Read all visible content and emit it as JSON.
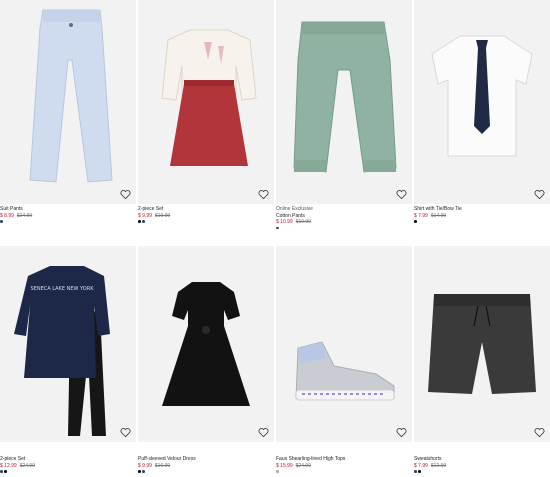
{
  "products": [
    {
      "badge": "",
      "title": "Suit Pants",
      "price": "$ 8.99",
      "original": "$24.99",
      "swatches": [
        "#31486b"
      ]
    },
    {
      "badge": "",
      "title": "2-piece Set",
      "price": "$ 9.99",
      "original": "$19.99",
      "swatches": [
        "#111111",
        "#31486b"
      ]
    },
    {
      "badge": "Online Exclusive",
      "title": "Cotton Pants",
      "price": "$ 10.99",
      "original": "$19.99",
      "swatches": [
        "#31486b"
      ]
    },
    {
      "badge": "",
      "title": "Shirt with Tie/Bow Tie",
      "price": "$ 7.99",
      "original": "$14.99",
      "swatches": [
        "#111111"
      ]
    },
    {
      "badge": "",
      "title": "2-piece Set",
      "price": "$ 12.99",
      "original": "$24.99",
      "swatches": [
        "#31486b",
        "#111111"
      ]
    },
    {
      "badge": "",
      "title": "Puff-sleeved Velour Dress",
      "price": "$ 9.99",
      "original": "$16.99",
      "swatches": [
        "#111111",
        "#31486b"
      ]
    },
    {
      "badge": "",
      "title": "Faux Shearling-lined High Tops",
      "price": "$ 15.99",
      "original": "$24.99",
      "swatches": [
        "#aaaaaa"
      ]
    },
    {
      "badge": "",
      "title": "Sweatshorts",
      "price": "$ 7.99",
      "original": "$12.99",
      "swatches": [
        "#31486b",
        "#111111"
      ]
    }
  ],
  "graphics": {
    "shirt_print": "SENECA LAKE NEW YORK",
    "icons": [
      "heart-icon"
    ],
    "colors": {
      "sale": "#c4112f",
      "image_bg": "#f2f2f2"
    }
  }
}
